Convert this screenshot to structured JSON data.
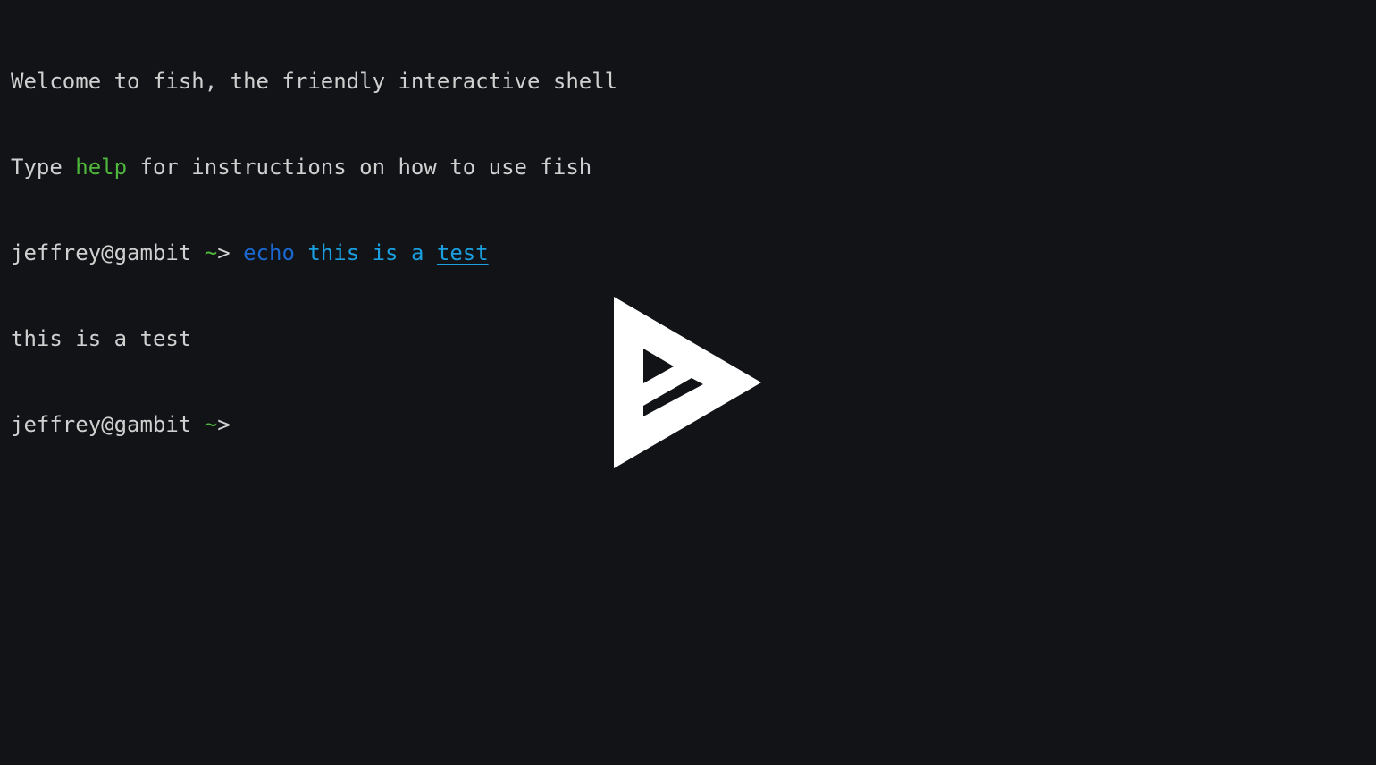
{
  "terminal": {
    "welcome_line": "Welcome to fish, the friendly interactive shell",
    "help_line": {
      "prefix": "Type ",
      "keyword": "help",
      "suffix": " for instructions on how to use fish"
    },
    "prompt": {
      "user_host": "jeffrey@gambit",
      "cwd": "~",
      "symbol": ">"
    },
    "command": {
      "name": "echo",
      "args": [
        "this",
        "is",
        "a",
        "test"
      ]
    },
    "output": "this is a test"
  },
  "player": {
    "play_icon": "asciinema-play-icon"
  },
  "colors": {
    "background": "#121316",
    "text": "#d0d0d0",
    "green": "#4fb83c",
    "command_blue": "#1a67d0",
    "arg_blue": "#1a9fe0"
  }
}
